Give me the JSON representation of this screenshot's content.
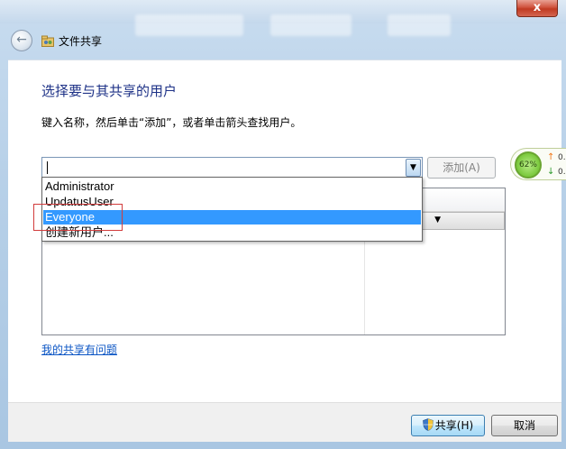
{
  "window": {
    "close_glyph": "x"
  },
  "nav": {
    "back_glyph": "←",
    "title": "文件共享"
  },
  "main": {
    "heading": "选择要与其共享的用户",
    "instruction": "键入名称，然后单击“添加”，或者单击箭头查找用户。",
    "combo_value": "",
    "combo_arrow_glyph": "▼",
    "add_button": "添加(A)",
    "permission_arrow_glyph": "▼"
  },
  "dropdown": {
    "items": [
      "Administrator",
      "UpdatusUser",
      "Everyone",
      "创建新用户..."
    ],
    "selected_index": 2
  },
  "help_link": "我的共享有问题",
  "footer": {
    "share_button": "共享(H)",
    "cancel_button": "取消"
  },
  "net_widget": {
    "percent": "62%",
    "up_value": "0.",
    "down_value": "0."
  },
  "colors": {
    "heading": "#1e3287",
    "selection": "#3399ff",
    "highlight_box": "#d23c3c",
    "link": "#0b55c4"
  }
}
